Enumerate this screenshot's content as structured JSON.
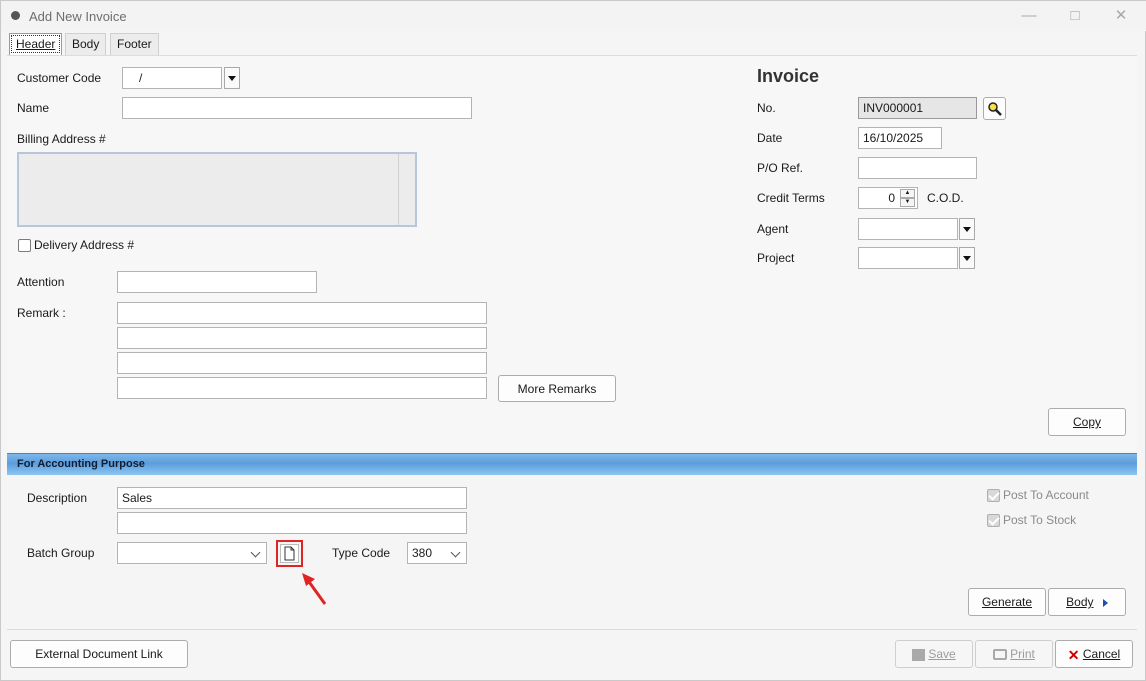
{
  "window": {
    "title": "Add New Invoice"
  },
  "tabs": [
    {
      "label": "Header",
      "active": true
    },
    {
      "label": "Body",
      "active": false
    },
    {
      "label": "Footer",
      "active": false
    }
  ],
  "customer": {
    "code_label": "Customer Code",
    "code_value": "/",
    "name_label": "Name",
    "name_value": "",
    "billing_label": "Billing Address #",
    "billing_value": "",
    "delivery_label": "Delivery Address #",
    "delivery_checked": false,
    "attention_label": "Attention",
    "attention_value": "",
    "remark_label": "Remark :",
    "remarks": [
      "",
      "",
      "",
      ""
    ],
    "more_remarks_label": "More Remarks"
  },
  "invoice": {
    "heading": "Invoice",
    "no_label": "No.",
    "no_value": "INV000001",
    "date_label": "Date",
    "date_value": "16/10/2025",
    "po_label": "P/O Ref.",
    "po_value": "",
    "credit_terms_label": "Credit Terms",
    "credit_terms_value": "0",
    "credit_terms_text": "C.O.D.",
    "agent_label": "Agent",
    "agent_value": "",
    "project_label": "Project",
    "project_value": ""
  },
  "copy_label": "Copy",
  "accounting": {
    "section_title": "For Accounting Purpose",
    "description_label": "Description",
    "description_value": "Sales",
    "description_value2": "",
    "batch_group_label": "Batch Group",
    "batch_group_value": "",
    "type_code_label": "Type Code",
    "type_code_value": "380",
    "post_to_account_label": "Post To Account",
    "post_to_stock_label": "Post To Stock",
    "generate_label": "Generate",
    "body_label": "Body"
  },
  "footer": {
    "external_link_label": "External Document Link",
    "save_label": "Save",
    "print_label": "Print",
    "cancel_label": "Cancel"
  },
  "annotation": {
    "color": "#e02424"
  }
}
